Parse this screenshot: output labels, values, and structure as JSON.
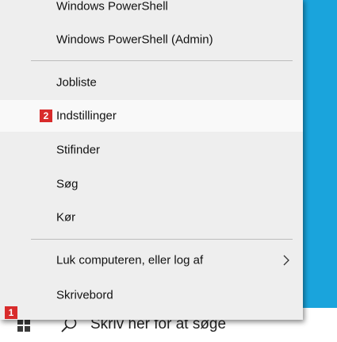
{
  "menu": {
    "items": [
      {
        "label": "Windows PowerShell"
      },
      {
        "label": "Windows PowerShell (Admin)"
      },
      {
        "label": "Jobliste"
      },
      {
        "label": "Indstillinger"
      },
      {
        "label": "Stifinder"
      },
      {
        "label": "Søg"
      },
      {
        "label": "Kør"
      },
      {
        "label": "Luk computeren, eller log af"
      },
      {
        "label": "Skrivebord"
      }
    ],
    "highlighted_item": "Indstillinger"
  },
  "taskbar": {
    "search_text": "Skriv her for at søge"
  },
  "badges": {
    "start_badge": "1",
    "settings_badge": "2"
  },
  "colors": {
    "desktop": "#1aa4dc",
    "menu_background": "#eeeeee",
    "highlight": "#f9f9f9",
    "badge": "#d82b2b"
  },
  "icons": {
    "start": "windows-logo-icon",
    "search": "search-icon",
    "submenu": "chevron-right-icon"
  }
}
